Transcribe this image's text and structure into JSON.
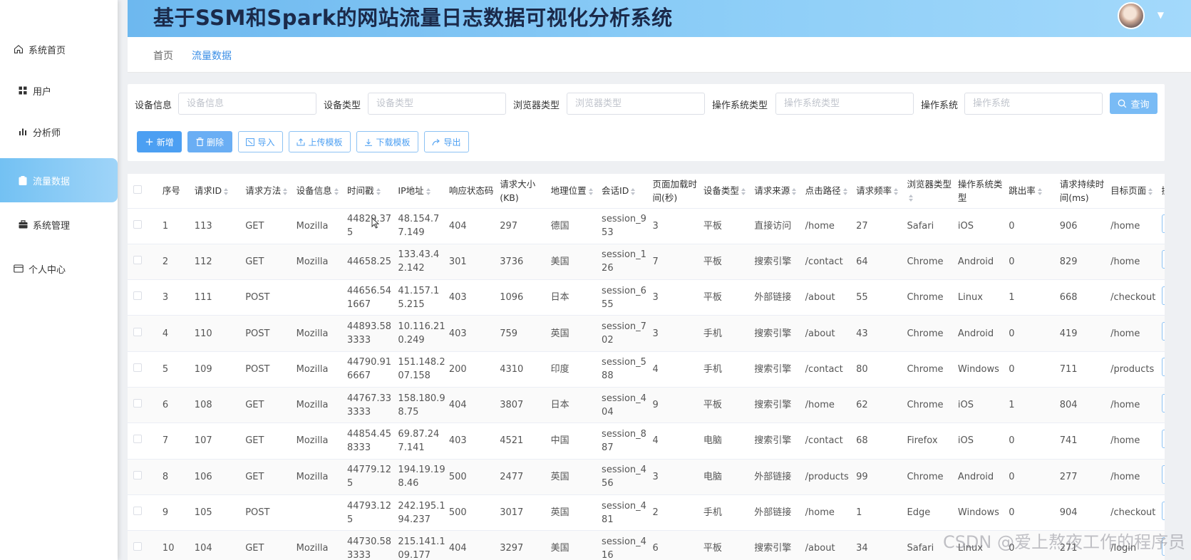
{
  "app": {
    "title": "基于SSM和Spark的网站流量日志数据可视化分析系统"
  },
  "sidebar": {
    "items": [
      {
        "label": "系统首页",
        "icon": "home-icon",
        "active": false
      },
      {
        "label": "用户",
        "icon": "grid-icon",
        "active": false
      },
      {
        "label": "分析师",
        "icon": "bar-chart-icon",
        "active": false
      },
      {
        "label": "流量数据",
        "icon": "clipboard-icon",
        "active": true
      },
      {
        "label": "系统管理",
        "icon": "briefcase-icon",
        "active": false
      },
      {
        "label": "个人中心",
        "icon": "card-icon",
        "active": false
      }
    ]
  },
  "breadcrumb": {
    "home": "首页",
    "current": "流量数据"
  },
  "filters": [
    {
      "label": "设备信息",
      "placeholder": "设备信息"
    },
    {
      "label": "设备类型",
      "placeholder": "设备类型"
    },
    {
      "label": "浏览器类型",
      "placeholder": "浏览器类型"
    },
    {
      "label": "操作系统类型",
      "placeholder": "操作系统类型"
    },
    {
      "label": "操作系统",
      "placeholder": "操作系统"
    }
  ],
  "actions": {
    "query": "查询",
    "add": "新增",
    "delete": "删除",
    "import": "导入",
    "upload_template": "上传模板",
    "download_template": "下载模板",
    "export": "导出"
  },
  "table": {
    "columns": [
      "序号",
      "请求ID",
      "请求方法",
      "设备信息",
      "时间戳",
      "IP地址",
      "响应状态码",
      "请求大小(KB)",
      "地理位置",
      "会话ID",
      "页面加载时间(秒)",
      "设备类型",
      "请求来源",
      "点击路径",
      "请求频率",
      "浏览器类型",
      "操作系统类型",
      "跳出率",
      "请求持续时间(ms)",
      "目标页面",
      "操作"
    ],
    "rows": [
      [
        "1",
        "113",
        "GET",
        "Mozilla",
        "44829.375",
        "48.154.77.149",
        "404",
        "297",
        "德国",
        "session_953",
        "3",
        "平板",
        "直接访问",
        "/home",
        "27",
        "Safari",
        "iOS",
        "0",
        "906",
        "/home"
      ],
      [
        "2",
        "112",
        "GET",
        "Mozilla",
        "44658.25",
        "133.43.42.142",
        "301",
        "3736",
        "美国",
        "session_126",
        "7",
        "平板",
        "搜索引擎",
        "/contact",
        "64",
        "Chrome",
        "Android",
        "0",
        "829",
        "/home"
      ],
      [
        "3",
        "111",
        "POST",
        "",
        "44656.541667",
        "41.157.15.215",
        "403",
        "1096",
        "日本",
        "session_655",
        "3",
        "平板",
        "外部链接",
        "/about",
        "55",
        "Chrome",
        "Linux",
        "1",
        "668",
        "/checkout"
      ],
      [
        "4",
        "110",
        "POST",
        "Mozilla",
        "44893.583333",
        "10.116.210.249",
        "403",
        "759",
        "英国",
        "session_702",
        "3",
        "手机",
        "搜索引擎",
        "/about",
        "43",
        "Chrome",
        "Android",
        "0",
        "419",
        "/home"
      ],
      [
        "5",
        "109",
        "POST",
        "Mozilla",
        "44790.916667",
        "151.148.207.158",
        "200",
        "4310",
        "印度",
        "session_588",
        "4",
        "手机",
        "搜索引擎",
        "/contact",
        "80",
        "Chrome",
        "Windows",
        "0",
        "711",
        "/products"
      ],
      [
        "6",
        "108",
        "GET",
        "Mozilla",
        "44767.333333",
        "158.180.98.75",
        "404",
        "3807",
        "日本",
        "session_404",
        "9",
        "平板",
        "搜索引擎",
        "/home",
        "62",
        "Chrome",
        "iOS",
        "1",
        "804",
        "/home"
      ],
      [
        "7",
        "107",
        "GET",
        "Mozilla",
        "44854.458333",
        "69.87.247.141",
        "403",
        "4521",
        "中国",
        "session_887",
        "4",
        "电脑",
        "搜索引擎",
        "/contact",
        "68",
        "Firefox",
        "iOS",
        "0",
        "741",
        "/home"
      ],
      [
        "8",
        "106",
        "GET",
        "Mozilla",
        "44779.125",
        "194.19.198.46",
        "500",
        "2477",
        "英国",
        "session_456",
        "3",
        "电脑",
        "外部链接",
        "/products",
        "99",
        "Chrome",
        "Android",
        "0",
        "277",
        "/home"
      ],
      [
        "9",
        "105",
        "POST",
        "",
        "44793.125",
        "242.195.194.237",
        "500",
        "3017",
        "英国",
        "session_481",
        "2",
        "手机",
        "外部链接",
        "/home",
        "1",
        "Edge",
        "Windows",
        "0",
        "904",
        "/checkout"
      ],
      [
        "10",
        "104",
        "GET",
        "Mozilla",
        "44730.583333",
        "215.141.109.177",
        "404",
        "3297",
        "美国",
        "session_416",
        "6",
        "平板",
        "搜索引擎",
        "/about",
        "34",
        "Safari",
        "Linux",
        "0",
        "271",
        "/login"
      ]
    ]
  },
  "watermark": "CSDN @爱上熬夜工作的程序员",
  "colors": {
    "accent": "#4c9ff2",
    "header_start": "#6db8ef",
    "active_nav": "#73c1f3"
  }
}
